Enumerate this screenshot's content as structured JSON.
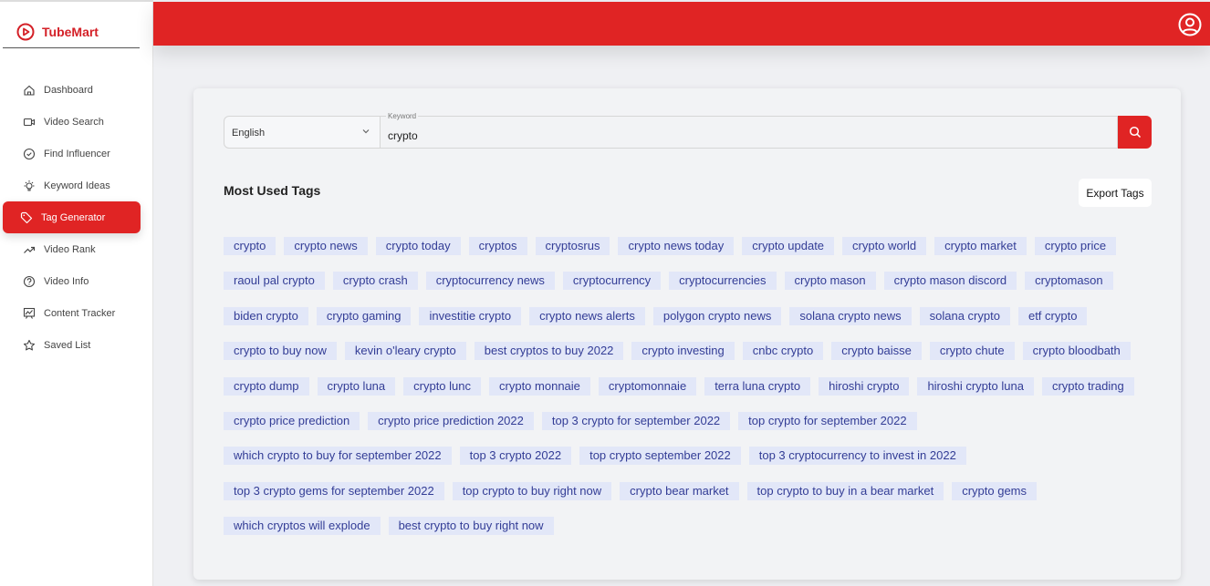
{
  "app": {
    "name": "TubeMart"
  },
  "sidebar": {
    "items": [
      {
        "label": "Dashboard",
        "icon": "home-icon"
      },
      {
        "label": "Video Search",
        "icon": "video-icon"
      },
      {
        "label": "Find Influencer",
        "icon": "check-circle-icon"
      },
      {
        "label": "Keyword Ideas",
        "icon": "lightbulb-icon"
      },
      {
        "label": "Tag Generator",
        "icon": "tag-icon",
        "active": true
      },
      {
        "label": "Video Rank",
        "icon": "trending-up-icon"
      },
      {
        "label": "Video Info",
        "icon": "help-circle-icon"
      },
      {
        "label": "Content Tracker",
        "icon": "chart-board-icon"
      },
      {
        "label": "Saved List",
        "icon": "star-icon"
      }
    ]
  },
  "search": {
    "language": "English",
    "keyword_label": "Keyword",
    "keyword_value": "crypto"
  },
  "main": {
    "title": "Most Used Tags",
    "export_label": "Export Tags"
  },
  "tag_rows": [
    [
      "crypto",
      "crypto news",
      "crypto today",
      "cryptos",
      "cryptosrus",
      "crypto news today",
      "crypto update",
      "crypto world",
      "crypto market",
      "crypto price"
    ],
    [
      "raoul pal crypto",
      "crypto crash",
      "cryptocurrency news",
      "cryptocurrency",
      "cryptocurrencies",
      "crypto mason",
      "crypto mason discord",
      "cryptomason"
    ],
    [
      "biden crypto",
      "crypto gaming",
      "investitie crypto",
      "crypto news alerts",
      "polygon crypto news",
      "solana crypto news",
      "solana crypto",
      "etf crypto"
    ],
    [
      "crypto to buy now",
      "kevin o'leary crypto",
      "best cryptos to buy 2022",
      "crypto investing",
      "cnbc crypto",
      "crypto baisse",
      "crypto chute",
      "crypto bloodbath"
    ],
    [
      "crypto dump",
      "crypto luna",
      "crypto lunc",
      "crypto monnaie",
      "cryptomonnaie",
      "terra luna crypto",
      "hiroshi crypto",
      "hiroshi crypto luna",
      "crypto trading"
    ],
    [
      "crypto price prediction",
      "crypto price prediction 2022",
      "top 3 crypto for september 2022",
      "top crypto for september 2022"
    ],
    [
      "which crypto to buy for september 2022",
      "top 3 crypto 2022",
      "top crypto september 2022",
      "top 3 cryptocurrency to invest in 2022"
    ],
    [
      "top 3 crypto gems for september 2022",
      "top crypto to buy right now",
      "crypto bear market",
      "top crypto to buy in a bear market",
      "crypto gems"
    ],
    [
      "which cryptos will explode",
      "best crypto to buy right now"
    ]
  ],
  "colors": {
    "brand": "#e02424",
    "tag_bg": "#e2e7f8",
    "tag_text": "#333d96"
  }
}
